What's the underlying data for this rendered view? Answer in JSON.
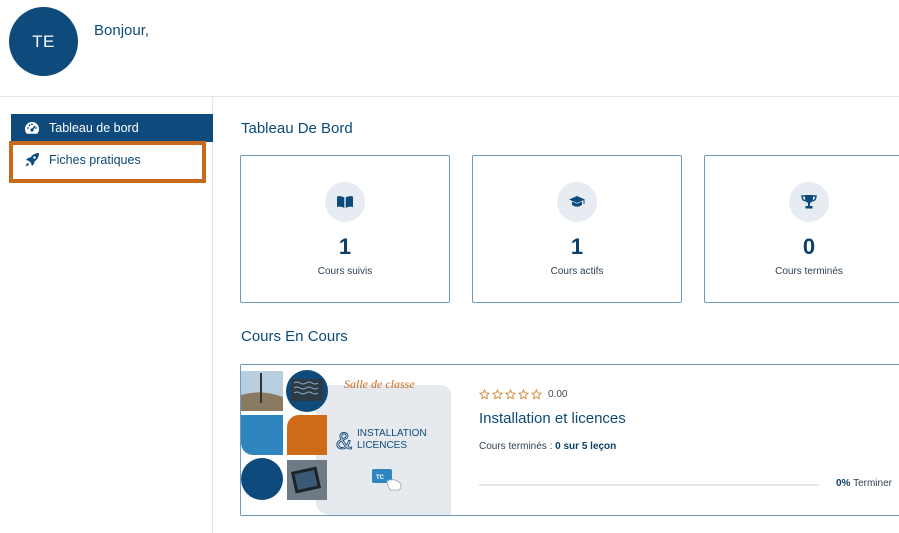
{
  "user": {
    "initials": "TE",
    "greeting": "Bonjour,"
  },
  "sidebar": {
    "items": [
      {
        "label": "Tableau de bord",
        "icon": "dashboard-gauge-icon",
        "active": true
      },
      {
        "label": "Fiches pratiques",
        "icon": "rocket-icon",
        "active": false
      }
    ],
    "highlight_color": "#c86a1b"
  },
  "dashboard": {
    "title": "Tableau De Bord",
    "stats": [
      {
        "value": "1",
        "label": "Cours suivis",
        "icon": "book-open-icon"
      },
      {
        "value": "1",
        "label": "Cours actifs",
        "icon": "graduation-cap-icon"
      },
      {
        "value": "0",
        "label": "Cours terminés",
        "icon": "trophy-icon"
      }
    ]
  },
  "courses_section": {
    "title": "Cours En Cours",
    "courses": [
      {
        "title": "Installation et licences",
        "rating": "0.00",
        "stars_filled": 0,
        "progress_label": "Cours terminés :",
        "progress_value": "0 sur 5 leçon",
        "percent_value": "0%",
        "percent_suffix": "Terminer",
        "progress_fraction": 0,
        "thumbnail": {
          "script_text": "Salle de classe",
          "amp": "&",
          "line1": "INSTALLATION",
          "line2": "LICENCES",
          "badge": "TC"
        }
      }
    ]
  },
  "colors": {
    "primary": "#0e4a7b",
    "accent": "#c86a1b",
    "card_border": "#6c9ac0",
    "star": "#d08a3a"
  }
}
